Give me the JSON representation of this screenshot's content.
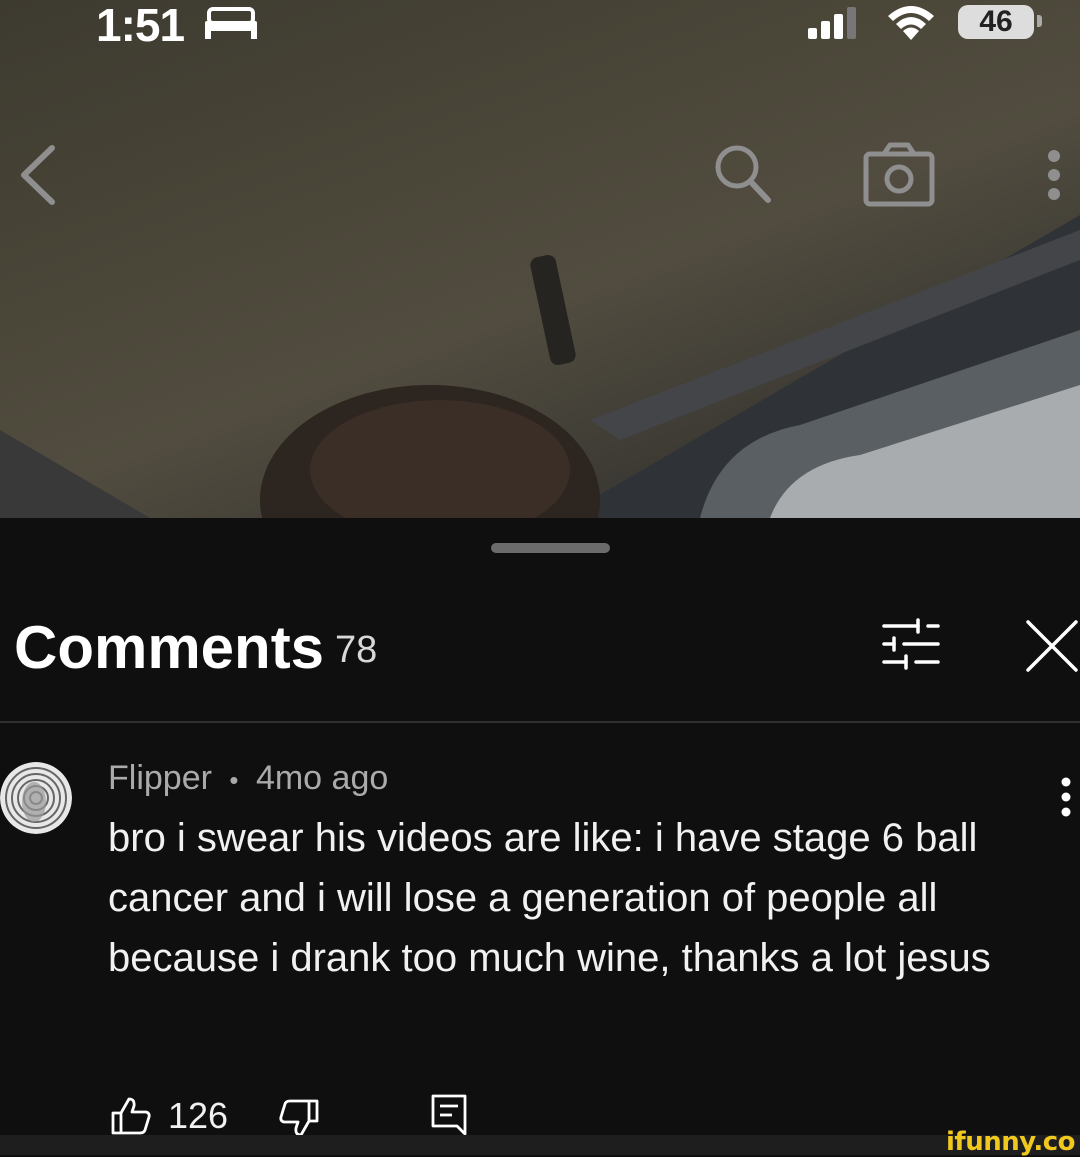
{
  "status_bar": {
    "time": "1:51",
    "battery": "46",
    "icons": [
      "bed-icon",
      "cellular-signal-icon",
      "wifi-icon",
      "battery-icon"
    ]
  },
  "video_toolbar": {
    "icons": [
      "back-chevron-icon",
      "search-icon",
      "camera-icon",
      "more-vertical-icon"
    ]
  },
  "comments": {
    "title": "Comments",
    "count": "78",
    "icons": [
      "sort-filter-icon",
      "close-icon"
    ],
    "items": [
      {
        "author": "Flipper",
        "time": "4mo ago",
        "separator": "•",
        "text": "bro i swear his videos are like: i have stage 6 ball cancer and i will lose a generation of people all because i drank too much wine, thanks a lot jesus",
        "likes": "126",
        "icons": [
          "avatar",
          "more-vertical-icon",
          "thumbs-up-icon",
          "thumbs-down-icon",
          "reply-icon"
        ]
      }
    ]
  },
  "watermark": "ifunny.co",
  "colors": {
    "background": "#0f0f0f",
    "text_primary": "#f1f1f1",
    "text_secondary": "#aaaaaa",
    "watermark": "#f0c81e"
  }
}
